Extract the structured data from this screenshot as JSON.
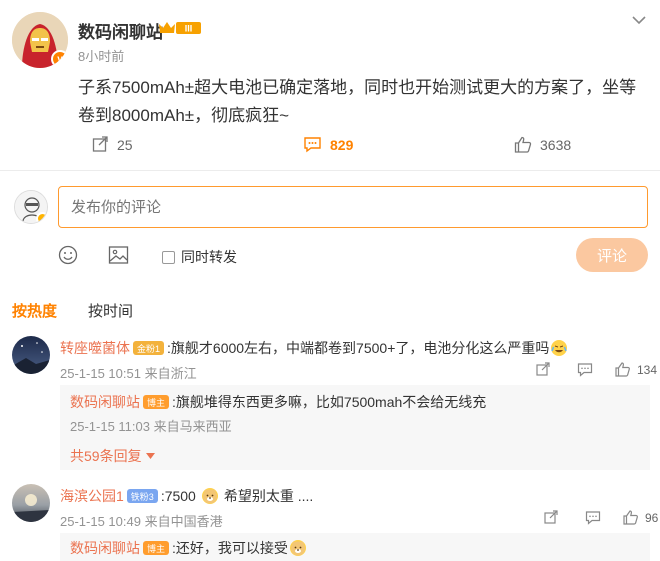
{
  "post": {
    "author": "数码闲聊站",
    "level_badge": "III",
    "time": "8小时前",
    "text": "子系7500mAh±超大电池已确定落地，同时也开始测试更大的方案了，坐等卷到8000mAh±，彻底疯狂~",
    "reposts": "25",
    "comments": "829",
    "likes": "3638"
  },
  "composer": {
    "placeholder": "发布你的评论",
    "repost_label": "同时转发",
    "submit_label": "评论"
  },
  "sort_tabs": {
    "hot": "按热度",
    "time": "按时间"
  },
  "comments": [
    {
      "user": "转座噬菌体",
      "badge": "金粉1",
      "text": ":旗舰才6000左右，中端都卷到7500+了，电池分化这么严重吗",
      "meta": "25-1-15 10:51 来自浙江",
      "likes": "134",
      "reply": {
        "user": "数码闲聊站",
        "badge": "博主",
        "text": ":旗舰堆得东西更多嘛，比如7500mah不会给无线充",
        "meta": "25-1-15 11:03 来自马来西亚"
      },
      "more_replies": "共59条回复"
    },
    {
      "user": "海滨公园1",
      "badge": "铁粉3",
      "text": ":7500",
      "text_after": "希望别太重 ....",
      "meta": "25-1-15 10:49 来自中国香港",
      "likes": "96",
      "reply": {
        "user": "数码闲聊站",
        "badge": "博主",
        "text": ":还好，我可以接受"
      }
    }
  ],
  "colors": {
    "accent": "#ff8200",
    "username": "#eb7350",
    "submit_disabled": "#fbc8a0"
  }
}
